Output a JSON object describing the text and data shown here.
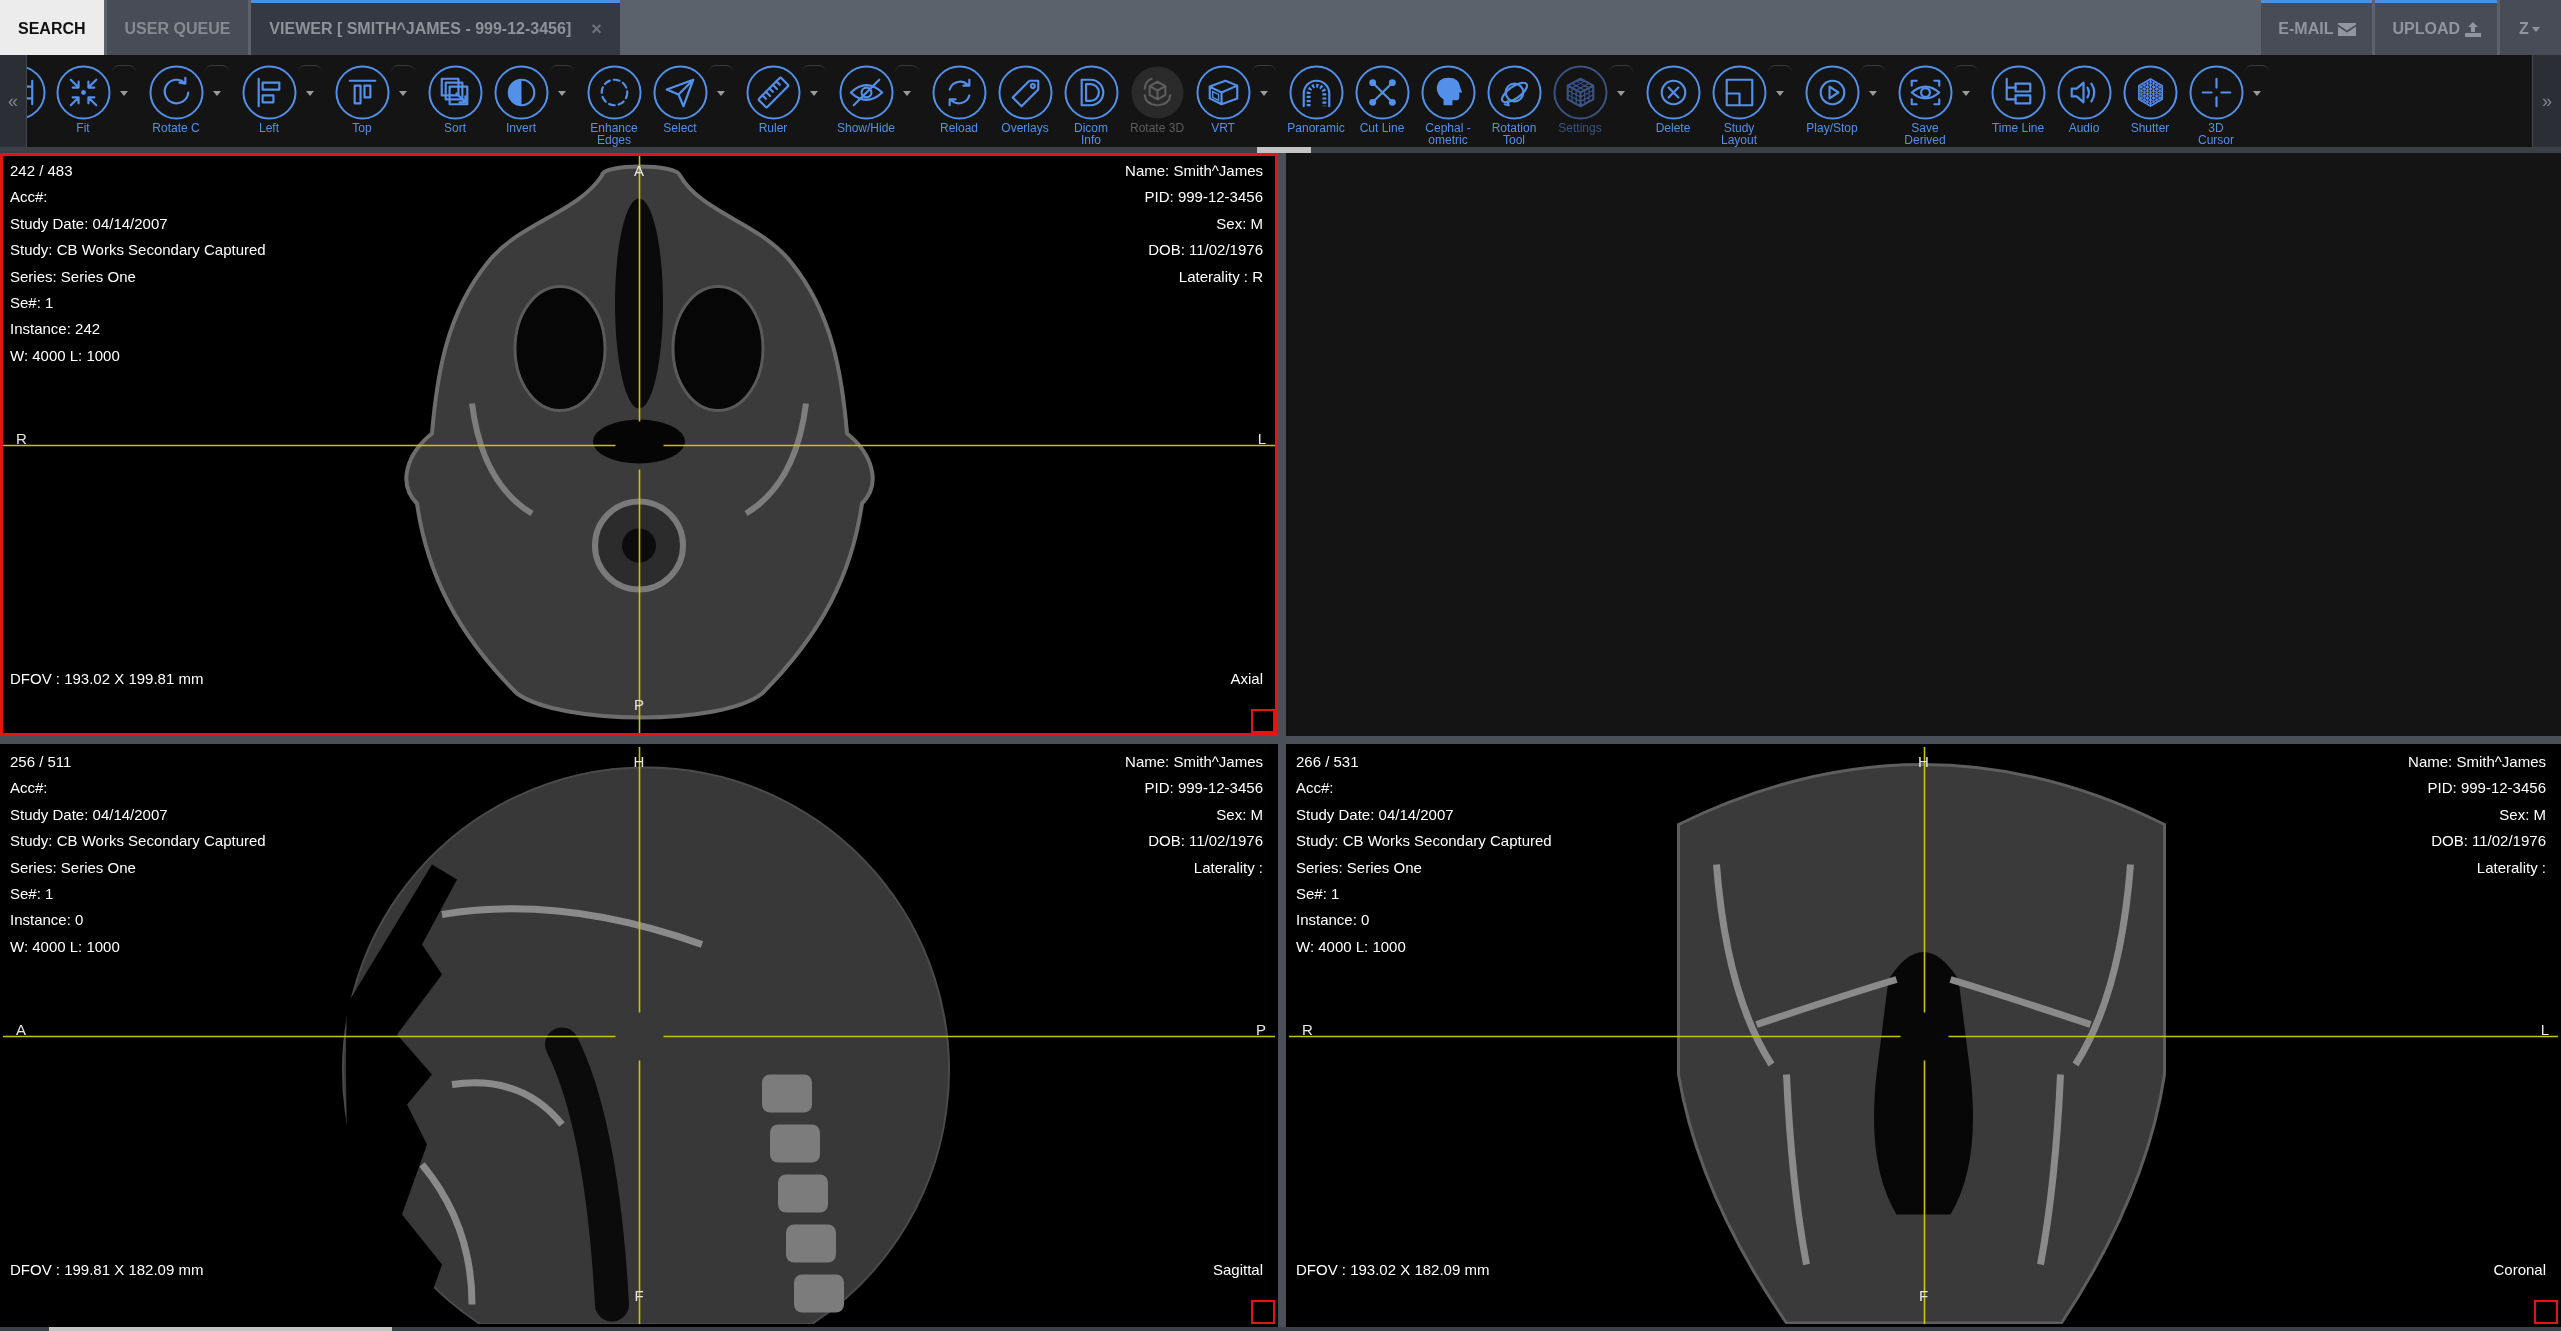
{
  "header": {
    "tabs": [
      {
        "label": "SEARCH",
        "kind": "home",
        "selected": false
      },
      {
        "label": "USER QUEUE",
        "kind": "tab",
        "selected": false
      },
      {
        "label": "VIEWER [ SMITH^JAMES - 999-12-3456]",
        "kind": "tab",
        "selected": true,
        "close": "×"
      }
    ],
    "actions": [
      {
        "kind": "email",
        "label": "E-MAIL"
      },
      {
        "kind": "upload",
        "label": "UPLOAD"
      },
      {
        "kind": "menu",
        "label": "Z"
      }
    ]
  },
  "toolbar": {
    "scroll_left": "«",
    "scroll_right": "»",
    "tools": [
      {
        "disabled": false,
        "dimmed": false,
        "dropdown": false
      },
      {
        "label": "Fit",
        "disabled": false,
        "dimmed": false,
        "dropdown": true
      },
      {
        "label": "Rotate C",
        "disabled": false,
        "dimmed": false,
        "dropdown": true
      },
      {
        "label": "Left",
        "disabled": false,
        "dimmed": false,
        "dropdown": true
      },
      {
        "label": "Top",
        "disabled": false,
        "dimmed": false,
        "dropdown": true
      },
      {
        "label": "Sort",
        "disabled": false,
        "dimmed": false,
        "dropdown": false
      },
      {
        "label": "Invert",
        "disabled": false,
        "dimmed": false,
        "dropdown": true
      },
      {
        "label": "Enhance\nEdges",
        "disabled": false,
        "dimmed": false,
        "dropdown": false
      },
      {
        "label": "Select",
        "disabled": false,
        "dimmed": false,
        "dropdown": true
      },
      {
        "label": "Ruler",
        "disabled": false,
        "dimmed": false,
        "dropdown": true
      },
      {
        "label": "Show/Hide",
        "disabled": false,
        "dimmed": false,
        "dropdown": true
      },
      {
        "label": "Reload",
        "disabled": false,
        "dimmed": false,
        "dropdown": false
      },
      {
        "label": "Overlays",
        "disabled": false,
        "dimmed": false,
        "dropdown": false
      },
      {
        "label": "Dicom\nInfo",
        "disabled": false,
        "dimmed": false,
        "dropdown": false
      },
      {
        "label": "Rotate 3D",
        "disabled": true,
        "dimmed": false,
        "dropdown": false
      },
      {
        "label": "VRT",
        "disabled": false,
        "dimmed": false,
        "dropdown": true
      },
      {
        "label": "Panoramic",
        "disabled": false,
        "dimmed": false,
        "dropdown": false
      },
      {
        "label": "Cut Line",
        "disabled": false,
        "dimmed": false,
        "dropdown": false
      },
      {
        "label": "Cephal -\nometric",
        "disabled": false,
        "dimmed": false,
        "dropdown": false
      },
      {
        "label": "Rotation\nTool",
        "disabled": false,
        "dimmed": false,
        "dropdown": false
      },
      {
        "label": "Settings",
        "disabled": false,
        "dimmed": true,
        "dropdown": true
      },
      {
        "label": "Delete",
        "disabled": false,
        "dimmed": false,
        "dropdown": false
      },
      {
        "label": "Study\nLayout",
        "disabled": false,
        "dimmed": false,
        "dropdown": true
      },
      {
        "label": "Play/Stop",
        "disabled": false,
        "dimmed": false,
        "dropdown": true
      },
      {
        "label": "Save\nDerived",
        "disabled": false,
        "dimmed": false,
        "dropdown": true
      },
      {
        "label": "Time Line",
        "disabled": false,
        "dimmed": false,
        "dropdown": false
      },
      {
        "label": "Audio",
        "disabled": false,
        "dimmed": false,
        "dropdown": false
      },
      {
        "label": "Shutter",
        "disabled": false,
        "dimmed": false,
        "dropdown": false
      },
      {
        "label": "3D\nCursor",
        "disabled": false,
        "dimmed": false,
        "dropdown": true
      }
    ]
  },
  "viewports": [
    {
      "kind": "axial",
      "selected": true,
      "info_left": {
        "image_count": "242 / 483",
        "accession": "Acc#:",
        "study_date": "Study Date: 04/14/2007",
        "study": "Study: CB Works Secondary Captured",
        "series": "Series: Series One",
        "series_number": "Se#: 1",
        "instance": "Instance: 242",
        "window_level": "W: 4000 L: 1000"
      },
      "info_right": {
        "name": "Name: Smith^James",
        "pid": "PID: 999-12-3456",
        "sex": "Sex: M",
        "dob": "DOB: 11/02/1976",
        "laterality": "Laterality : R"
      },
      "dfov": "DFOV : 193.02 X 199.81 mm",
      "view_name": "Axial",
      "markers": {
        "top": "A",
        "bottom": "P",
        "left": "R",
        "right": "L"
      }
    },
    {
      "kind": "empty",
      "selected": false
    },
    {
      "kind": "sagittal",
      "selected": false,
      "info_left": {
        "image_count": "256 / 511",
        "accession": "Acc#:",
        "study_date": "Study Date: 04/14/2007",
        "study": "Study: CB Works Secondary Captured",
        "series": "Series: Series One",
        "series_number": "Se#: 1",
        "instance": "Instance: 0",
        "window_level": "W: 4000 L: 1000"
      },
      "info_right": {
        "name": "Name: Smith^James",
        "pid": "PID: 999-12-3456",
        "sex": "Sex: M",
        "dob": "DOB: 11/02/1976",
        "laterality": "Laterality :"
      },
      "dfov": "DFOV : 199.81 X 182.09 mm",
      "view_name": "Sagittal",
      "markers": {
        "top": "H",
        "bottom": "F",
        "left": "A",
        "right": "P"
      }
    },
    {
      "kind": "coronal",
      "selected": false,
      "info_left": {
        "image_count": "266 / 531",
        "accession": "Acc#:",
        "study_date": "Study Date: 04/14/2007",
        "study": "Study: CB Works Secondary Captured",
        "series": "Series: Series One",
        "series_number": "Se#: 1",
        "instance": "Instance: 0",
        "window_level": "W: 4000 L: 1000"
      },
      "info_right": {
        "name": "Name: Smith^James",
        "pid": "PID: 999-12-3456",
        "sex": "Sex: M",
        "dob": "DOB: 11/02/1976",
        "laterality": "Laterality :"
      },
      "dfov": "DFOV : 193.02 X 182.09 mm",
      "view_name": "Coronal",
      "markers": {
        "top": "H",
        "bottom": "F",
        "left": "R",
        "right": "L"
      }
    }
  ]
}
